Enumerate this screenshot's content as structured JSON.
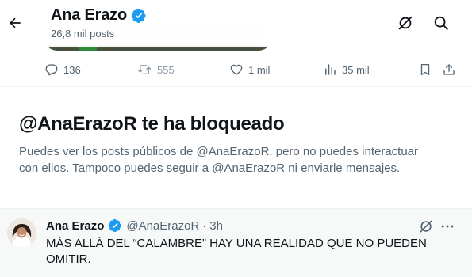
{
  "header": {
    "name": "Ana Erazo",
    "post_count": "26,8 mil posts",
    "icons": [
      "back-arrow-icon",
      "verified-badge-icon",
      "grok-icon",
      "search-icon"
    ]
  },
  "engagement": {
    "replies": "136",
    "reposts": "555",
    "likes": "1 mil",
    "views": "35 mil",
    "icons": [
      "reply-icon",
      "repost-icon",
      "like-icon",
      "views-icon",
      "bookmark-icon",
      "share-icon"
    ]
  },
  "blocked_notice": {
    "title": "@AnaErazoR te ha bloqueado",
    "body": "Puedes ver los posts públicos de @AnaErazoR, pero no puedes interactuar con ellos. Tampoco puedes seguir a @AnaErazoR ni enviarle mensajes."
  },
  "tweet": {
    "author_name": "Ana Erazo",
    "handle": "@AnaErazoR",
    "separator": "·",
    "time": "3h",
    "text": "MÁS ALLÁ DEL “CALAMBRE” HAY UNA REALIDAD QUE NO PUEDEN OMITIR."
  },
  "colors": {
    "text_primary": "#0f1419",
    "text_secondary": "#536471",
    "verified_blue": "#1d9bf0",
    "repost_disabled": "#8b98a5",
    "divider": "#eff3f4",
    "tweet_bg": "#f7f9f9"
  }
}
